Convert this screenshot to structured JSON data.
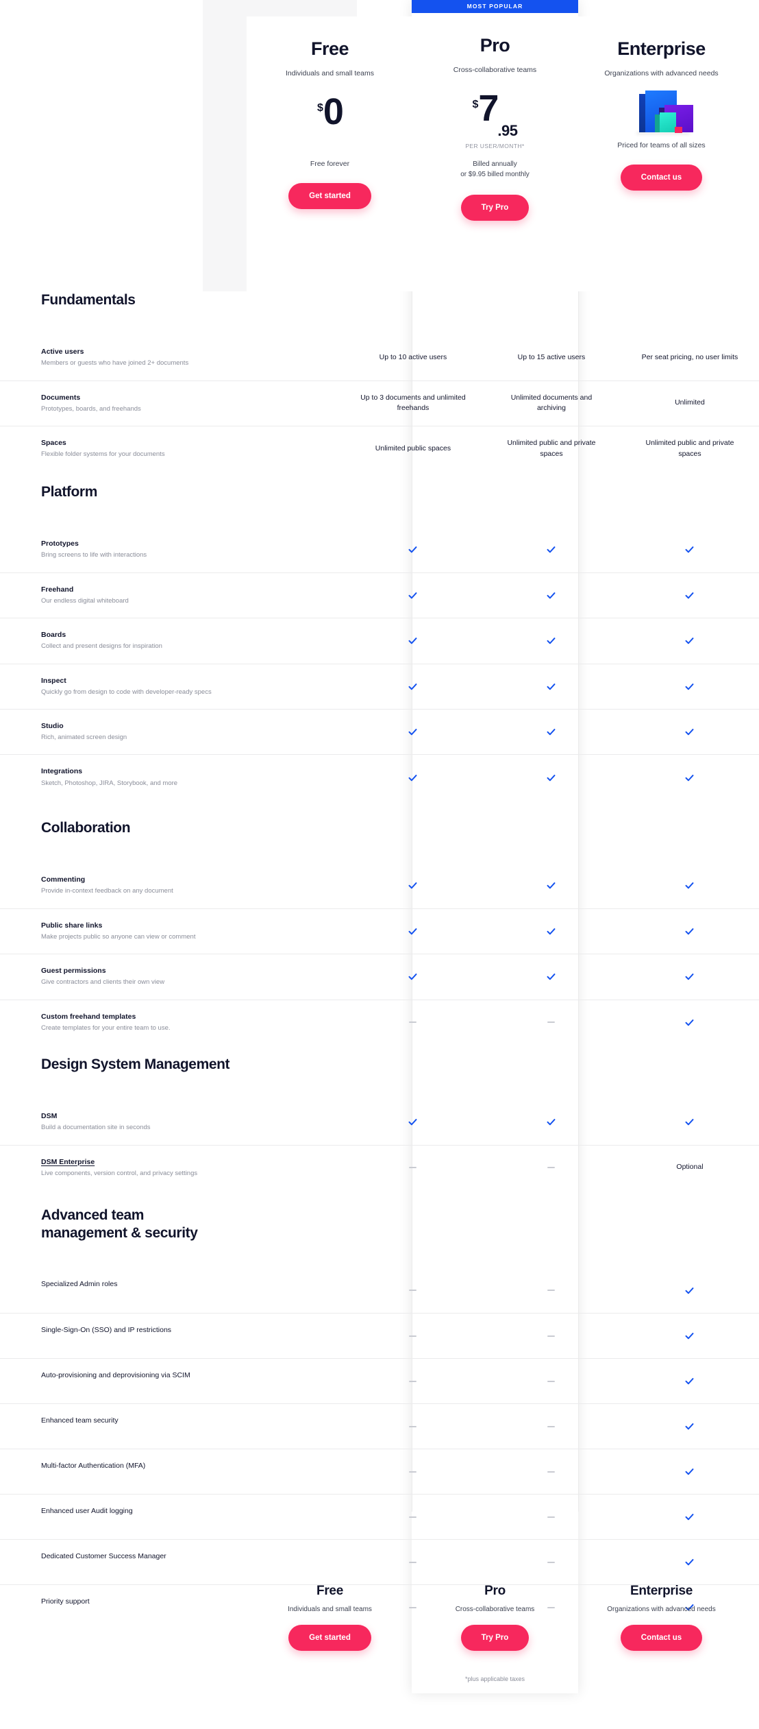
{
  "colors": {
    "accent_blue": "#1452ef",
    "cta_pink": "#f7285d",
    "text_dark": "#11142b",
    "text_muted": "#8a8d99",
    "band_gray": "#f6f6f7"
  },
  "plans": [
    {
      "id": "free",
      "name": "Free",
      "tagline": "Individuals and small teams",
      "badge": "",
      "currency": "$",
      "amount": "0",
      "cents": "",
      "per_unit": "",
      "billing_line1": "Free forever",
      "billing_line2": "",
      "cta_label": "Get started"
    },
    {
      "id": "pro",
      "name": "Pro",
      "tagline": "Cross-collaborative teams",
      "badge": "MOST POPULAR",
      "currency": "$",
      "amount": "7",
      "cents": ".95",
      "per_unit": "PER USER/MONTH*",
      "billing_line1": "Billed annually",
      "billing_line2": "or $9.95 billed monthly",
      "cta_label": "Try Pro"
    },
    {
      "id": "enterprise",
      "name": "Enterprise",
      "tagline": "Organizations with advanced needs",
      "badge": "",
      "currency": "",
      "amount": "",
      "cents": "",
      "per_unit": "",
      "billing_line1": "Priced for teams of all sizes",
      "billing_line2": "",
      "cta_label": "Contact us"
    }
  ],
  "sections": [
    {
      "title": "Fundamentals",
      "rows": [
        {
          "name": "Active users",
          "desc": "Members or guests who have joined 2+ documents",
          "link": false,
          "values": [
            "Up to 10 active users",
            "Up to 15 active users",
            "Per seat pricing, no user limits"
          ]
        },
        {
          "name": "Documents",
          "desc": "Prototypes, boards, and freehands",
          "link": false,
          "values": [
            "Up to 3 documents and unlimited freehands",
            "Unlimited documents and archiving",
            "Unlimited"
          ]
        },
        {
          "name": "Spaces",
          "desc": "Flexible folder systems for your documents",
          "link": false,
          "values": [
            "Unlimited public spaces",
            "Unlimited public and private spaces",
            "Unlimited public and private spaces"
          ]
        }
      ]
    },
    {
      "title": "Platform",
      "rows": [
        {
          "name": "Prototypes",
          "desc": "Bring screens to life with interactions",
          "link": false,
          "values": [
            "check",
            "check",
            "check"
          ]
        },
        {
          "name": "Freehand",
          "desc": "Our endless digital whiteboard",
          "link": false,
          "values": [
            "check",
            "check",
            "check"
          ]
        },
        {
          "name": "Boards",
          "desc": "Collect and present designs for inspiration",
          "link": false,
          "values": [
            "check",
            "check",
            "check"
          ]
        },
        {
          "name": "Inspect",
          "desc": "Quickly go from design to code with developer-ready specs",
          "link": false,
          "values": [
            "check",
            "check",
            "check"
          ]
        },
        {
          "name": "Studio",
          "desc": "Rich, animated screen design",
          "link": false,
          "values": [
            "check",
            "check",
            "check"
          ]
        },
        {
          "name": "Integrations",
          "desc": "Sketch, Photoshop, JIRA, Storybook, and more",
          "link": false,
          "values": [
            "check",
            "check",
            "check"
          ]
        }
      ]
    },
    {
      "title": "Collaboration",
      "rows": [
        {
          "name": "Commenting",
          "desc": "Provide in-context feedback on any document",
          "link": false,
          "values": [
            "check",
            "check",
            "check"
          ]
        },
        {
          "name": "Public share links",
          "desc": "Make projects public so anyone can view or comment",
          "link": false,
          "values": [
            "check",
            "check",
            "check"
          ]
        },
        {
          "name": "Guest permissions",
          "desc": "Give contractors and clients their own view",
          "link": false,
          "values": [
            "check",
            "check",
            "check"
          ]
        },
        {
          "name": "Custom freehand templates",
          "desc": "Create templates for your entire team to use.",
          "link": false,
          "values": [
            "dash",
            "dash",
            "check"
          ]
        }
      ]
    },
    {
      "title": "Design System Management",
      "rows": [
        {
          "name": "DSM",
          "desc": "Build a documentation site in seconds",
          "link": false,
          "values": [
            "check",
            "check",
            "check"
          ]
        },
        {
          "name": "DSM Enterprise",
          "desc": "Live components, version control, and privacy settings",
          "link": true,
          "values": [
            "dash",
            "dash",
            "Optional"
          ]
        }
      ]
    },
    {
      "title": "Advanced team management & security",
      "rows": [
        {
          "name": "Specialized Admin roles",
          "desc": "",
          "link": false,
          "values": [
            "dash",
            "dash",
            "check"
          ]
        },
        {
          "name": "Single-Sign-On (SSO) and IP restrictions",
          "desc": "",
          "link": false,
          "values": [
            "dash",
            "dash",
            "check"
          ]
        },
        {
          "name": "Auto-provisioning and deprovisioning via SCIM",
          "desc": "",
          "link": false,
          "values": [
            "dash",
            "dash",
            "check"
          ]
        },
        {
          "name": "Enhanced team security",
          "desc": "",
          "link": false,
          "values": [
            "dash",
            "dash",
            "check"
          ]
        },
        {
          "name": "Multi-factor Authentication (MFA)",
          "desc": "",
          "link": false,
          "values": [
            "dash",
            "dash",
            "check"
          ]
        },
        {
          "name": "Enhanced user Audit logging",
          "desc": "",
          "link": false,
          "values": [
            "dash",
            "dash",
            "check"
          ]
        },
        {
          "name": "Dedicated Customer Success Manager",
          "desc": "",
          "link": false,
          "values": [
            "dash",
            "dash",
            "check"
          ]
        },
        {
          "name": "Priority support",
          "desc": "",
          "link": false,
          "values": [
            "dash",
            "dash",
            "check"
          ]
        }
      ]
    }
  ],
  "footer": {
    "plans": [
      {
        "name": "Free",
        "tagline": "Individuals and small teams",
        "cta_label": "Get started"
      },
      {
        "name": "Pro",
        "tagline": "Cross-collaborative teams",
        "cta_label": "Try Pro"
      },
      {
        "name": "Enterprise",
        "tagline": "Organizations with advanced needs",
        "cta_label": "Contact us"
      }
    ],
    "tax_note": "*plus applicable taxes"
  }
}
